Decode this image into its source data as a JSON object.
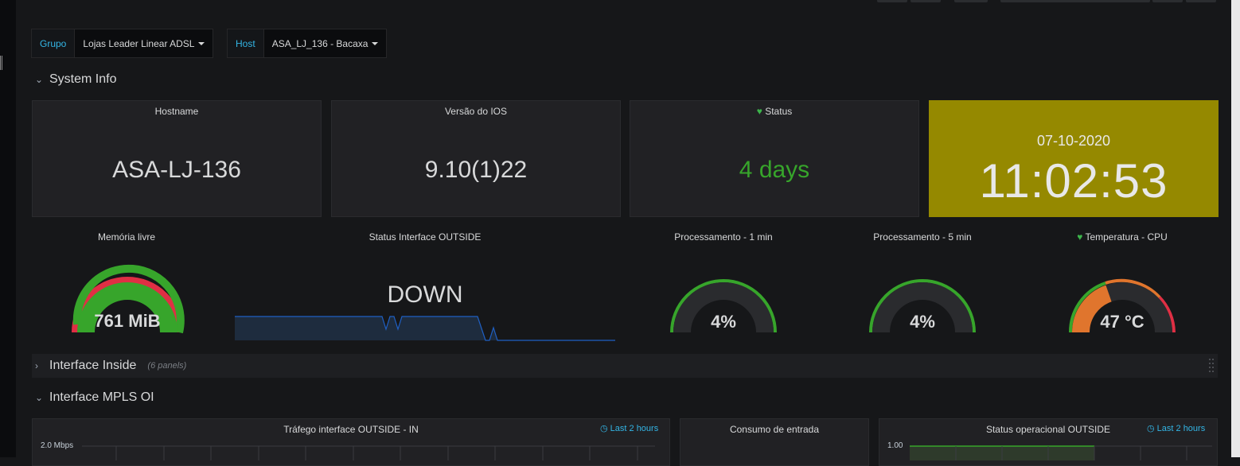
{
  "variables": {
    "grupo": {
      "label": "Grupo",
      "value": "Lojas Leader Linear ADSL"
    },
    "host": {
      "label": "Host",
      "value": "ASA_LJ_136 - Bacaxa"
    }
  },
  "rows": {
    "system_info": "System Info",
    "interface_inside": "Interface Inside",
    "interface_inside_count": "(6 panels)",
    "interface_mpls": "Interface MPLS OI"
  },
  "stats": {
    "hostname": {
      "title": "Hostname",
      "value": "ASA-LJ-136"
    },
    "ios": {
      "title": "Versão do IOS",
      "value": "9.10(1)22"
    },
    "status": {
      "title": "Status",
      "value": "4 days"
    },
    "clock": {
      "date": "07-10-2020",
      "time": "11:02:53"
    }
  },
  "gauges": {
    "memoria": {
      "title": "Memória livre",
      "value": "761 MiB",
      "fraction": 0.97
    },
    "outside": {
      "title": "Status Interface OUTSIDE",
      "value": "DOWN"
    },
    "proc1": {
      "title": "Processamento - 1 min",
      "value": "4%",
      "fraction": 0.04
    },
    "proc5": {
      "title": "Processamento - 5 min",
      "value": "4%",
      "fraction": 0.04
    },
    "temp": {
      "title": "Temperatura - CPU",
      "value": "47 °C",
      "fraction": 0.47
    }
  },
  "bottom": {
    "trafego": {
      "title": "Tráfego interface OUTSIDE - IN",
      "range": "Last 2 hours",
      "ytick": "2.0 Mbps"
    },
    "consumo": {
      "title": "Consumo de entrada"
    },
    "status_op": {
      "title": "Status operacional OUTSIDE",
      "range": "Last 2 hours",
      "ytick": "1.00"
    }
  },
  "colors": {
    "accent": "#33b5e5",
    "ok_green": "#37a52b",
    "warn_orange": "#e0752d",
    "crit_red": "#e02f44",
    "clock_bg": "#958900",
    "spark_line": "#1f60c4"
  },
  "icons": {
    "heart": "heart-icon",
    "clock": "clock-icon",
    "drag": "drag-handle-icon"
  }
}
